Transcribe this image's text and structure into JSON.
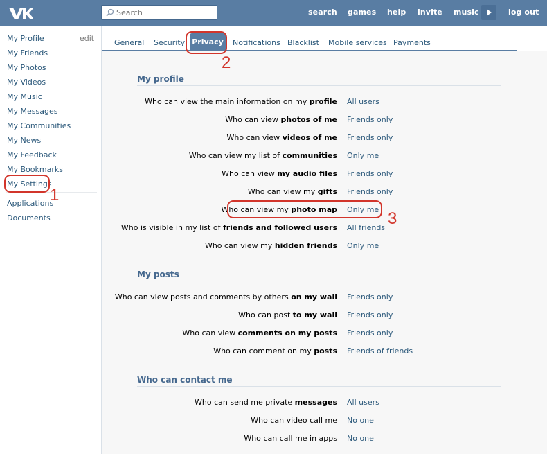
{
  "header": {
    "search_placeholder": "Search",
    "nav": [
      {
        "label": "games"
      },
      {
        "label": "help"
      },
      {
        "label": "invite"
      },
      {
        "label": "music"
      }
    ],
    "search_link": "search",
    "logout": "log out"
  },
  "sidebar": {
    "edit": "edit",
    "items": [
      {
        "label": "My Profile"
      },
      {
        "label": "My Friends"
      },
      {
        "label": "My Photos"
      },
      {
        "label": "My Videos"
      },
      {
        "label": "My Music"
      },
      {
        "label": "My Messages"
      },
      {
        "label": "My Communities"
      },
      {
        "label": "My News"
      },
      {
        "label": "My Feedback"
      },
      {
        "label": "My Bookmarks"
      },
      {
        "label": "My Settings"
      },
      {
        "label": "Applications"
      },
      {
        "label": "Documents"
      }
    ]
  },
  "tabs": [
    {
      "label": "General"
    },
    {
      "label": "Security"
    },
    {
      "label": "Privacy"
    },
    {
      "label": "Notifications"
    },
    {
      "label": "Blacklist"
    },
    {
      "label": "Mobile services"
    },
    {
      "label": "Payments"
    }
  ],
  "sections": [
    {
      "title": "My profile",
      "rows": [
        {
          "pre": "Who can view the main information on my ",
          "bold": "profile",
          "value": "All users"
        },
        {
          "pre": "Who can view ",
          "bold": "photos of me",
          "value": "Friends only"
        },
        {
          "pre": "Who can view ",
          "bold": "videos of me",
          "value": "Friends only"
        },
        {
          "pre": "Who can view my list of ",
          "bold": "communities",
          "value": "Only me"
        },
        {
          "pre": "Who can view ",
          "bold": "my audio files",
          "value": "Friends only"
        },
        {
          "pre": "Who can view my ",
          "bold": "gifts",
          "value": "Friends only"
        },
        {
          "pre": "Who can view my ",
          "bold": "photo map",
          "value": "Only me"
        },
        {
          "pre": "Who is visible in my list of ",
          "bold": "friends and followed users",
          "value": "All friends"
        },
        {
          "pre": "Who can view my ",
          "bold": "hidden friends",
          "value": "Only me"
        }
      ]
    },
    {
      "title": "My posts",
      "rows": [
        {
          "pre": "Who can view posts and comments by others ",
          "bold": "on my wall",
          "value": "Friends only"
        },
        {
          "pre": "Who can post ",
          "bold": "to my wall",
          "value": "Friends only"
        },
        {
          "pre": "Who can view ",
          "bold": "comments on my posts",
          "value": "Friends only"
        },
        {
          "pre": "Who can comment on my ",
          "bold": "posts",
          "value": "Friends of friends"
        }
      ]
    },
    {
      "title": "Who can contact me",
      "rows": [
        {
          "pre": "Who can send me private ",
          "bold": "messages",
          "value": "All users"
        },
        {
          "pre": "Who can video call me",
          "bold": "",
          "value": "No one"
        },
        {
          "pre": "Who can call me in apps",
          "bold": "",
          "value": "No one"
        }
      ]
    }
  ],
  "annotations": {
    "one": "1",
    "two": "2",
    "three": "3"
  },
  "colors": {
    "header": "#597da3",
    "link": "#2b587a",
    "annotation": "#d2352b"
  }
}
